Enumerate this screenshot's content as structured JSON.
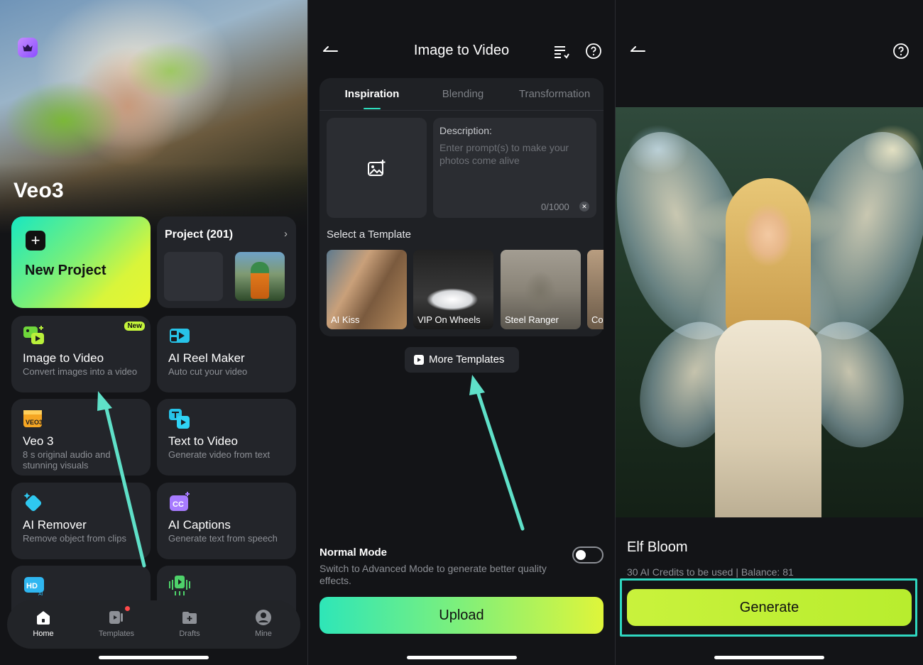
{
  "home": {
    "hero_title": "Veo3",
    "new_project": {
      "label": "New Project"
    },
    "project": {
      "title": "Project (201)"
    },
    "cards": [
      {
        "name": "image-to-video-card",
        "icon": "image-video-icon",
        "title": "Image to Video",
        "subtitle": "Convert images into a video",
        "badge": "New"
      },
      {
        "name": "ai-reel-maker-card",
        "icon": "reel-icon",
        "title": "AI Reel Maker",
        "subtitle": "Auto cut your video"
      },
      {
        "name": "veo3-card",
        "icon": "veo3-icon",
        "title": "Veo 3",
        "subtitle": "8 s original audio and stunning visuals"
      },
      {
        "name": "text-to-video-card",
        "icon": "text-video-icon",
        "title": "Text to Video",
        "subtitle": "Generate video from text"
      },
      {
        "name": "ai-remover-card",
        "icon": "eraser-icon",
        "title": "AI Remover",
        "subtitle": "Remove object from clips"
      },
      {
        "name": "ai-captions-card",
        "icon": "captions-icon",
        "title": "AI Captions",
        "subtitle": "Generate text from speech"
      }
    ],
    "tabbar": [
      {
        "label": "Home",
        "icon": "home-icon"
      },
      {
        "label": "Templates",
        "icon": "templates-icon"
      },
      {
        "label": "Drafts",
        "icon": "drafts-icon"
      },
      {
        "label": "Mine",
        "icon": "user-icon"
      }
    ],
    "hd_badge": "HD",
    "hd_ai": "AI",
    "cc_text": "CC",
    "veo_label": "VEO3"
  },
  "image_to_video": {
    "title": "Image to Video",
    "tabs": [
      "Inspiration",
      "Blending",
      "Transformation"
    ],
    "description_label": "Description:",
    "description_placeholder": "Enter prompt(s) to make your photos come alive",
    "char_count": "0/1000",
    "select_template_label": "Select a Template",
    "templates": [
      "AI Kiss",
      "VIP On Wheels",
      "Steel Ranger",
      "Co"
    ],
    "more_templates": "More Templates",
    "mode_title": "Normal Mode",
    "mode_subtitle": "Switch to Advanced Mode to generate better quality effects.",
    "upload_label": "Upload"
  },
  "result": {
    "title": "Elf Bloom",
    "credits": "30 AI Credits to be used |  Balance: 81",
    "generate_label": "Generate"
  },
  "colors": {
    "accent": "#2ee0c0",
    "highlight_frame": "#2fd7c0",
    "annotation_arrow": "#5fe0c8"
  }
}
